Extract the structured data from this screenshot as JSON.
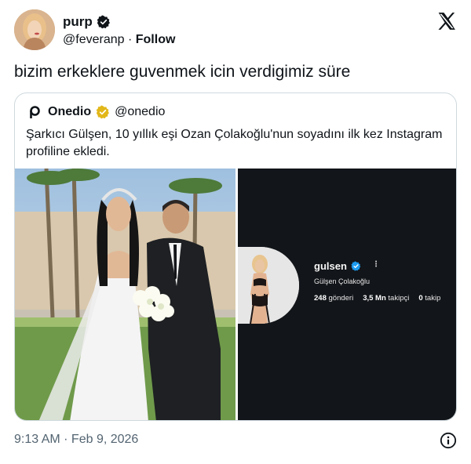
{
  "author": {
    "name": "purp",
    "handle": "@feveranp",
    "separator": "·",
    "follow_label": "Follow"
  },
  "tweet": {
    "text": "bizim erkeklere guvenmek icin verdigimiz süre",
    "time": "9:13 AM · Feb 9, 2026"
  },
  "quoted": {
    "name": "Onedio",
    "handle": "@onedio",
    "text": "Şarkıcı Gülşen, 10 yıllık eşi Ozan Çolakoğlu'nun soyadını ilk kez Instagram profiline ekledi."
  },
  "instagram_card": {
    "username": "gulsen",
    "full_name": "Gülşen Çolakoğlu",
    "more": "⋮",
    "posts_value": "248",
    "posts_label": "gönderi",
    "followers_value": "3,5 Mn",
    "followers_label": "takipçi",
    "following_value": "0",
    "following_label": "takip"
  },
  "colors": {
    "text": "#0f1419",
    "muted": "#536471",
    "border": "#cfd9de",
    "verified_blue": "#1d9bf0",
    "verified_gold": "#e2b719",
    "ig_background": "#121519"
  },
  "icons": [
    "verified-badge-icon",
    "x-logo-icon",
    "onedio-logo-icon",
    "info-icon"
  ]
}
